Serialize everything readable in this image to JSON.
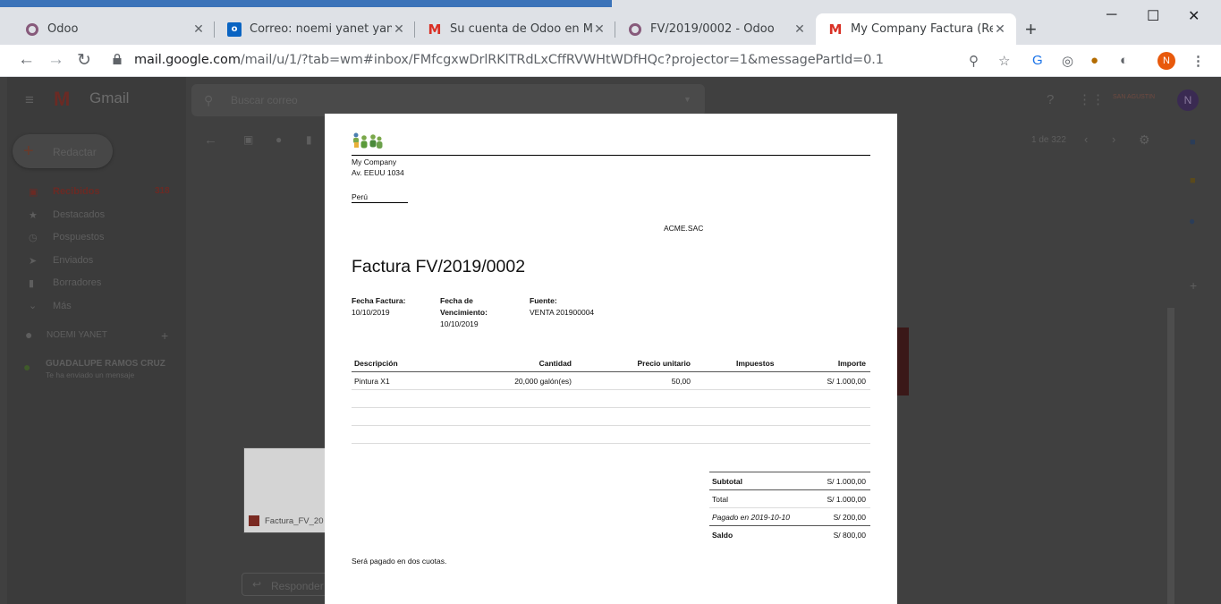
{
  "browser": {
    "tabs": [
      {
        "label": "Odoo",
        "icon": "odoo-icon"
      },
      {
        "label": "Correo: noemi yanet yanqui cu",
        "icon": "outlook-icon"
      },
      {
        "label": "Su cuenta de Odoo en My Cor",
        "icon": "gmail-icon"
      },
      {
        "label": "FV/2019/0002 - Odoo",
        "icon": "odoo-icon"
      },
      {
        "label": "My Company Factura (Ref FV/",
        "icon": "gmail-icon"
      }
    ],
    "url_host": "mail.google.com",
    "url_path": "/mail/u/1/?tab=wm#inbox/FMfcgxwDrlRKlTRdLxCffRVWHtWDfHQc?projector=1&messagePartId=0.1",
    "profile_initial": "N"
  },
  "gmail": {
    "logo": "Gmail",
    "search_placeholder": "Buscar correo",
    "compose": "Redactar",
    "nav": [
      {
        "label": "Recibidos",
        "count": "318"
      },
      {
        "label": "Destacados",
        "count": ""
      },
      {
        "label": "Pospuestos",
        "count": ""
      },
      {
        "label": "Enviados",
        "count": ""
      },
      {
        "label": "Borradores",
        "count": ""
      },
      {
        "label": "Más",
        "count": ""
      }
    ],
    "user": "NOEMI YANET",
    "chat_name": "GUADALUPE RAMOS CRUZ",
    "chat_msg": "Te ha enviado un mensaje",
    "pager": "1 de 322",
    "attachment": "Factura_FV_20",
    "reply": "Responder",
    "org_badge": "SAN AGUSTIN",
    "avatar_initial": "N"
  },
  "invoice": {
    "company_name": "My Company",
    "company_address": "Av. EEUU 1034",
    "company_country": "Perú",
    "customer": "ACME.SAC",
    "title": "Factura FV/2019/0002",
    "date_label": "Fecha Factura:",
    "date_value": "10/10/2019",
    "due_label_1": "Fecha de",
    "due_label_2": "Vencimiento:",
    "due_value": "10/10/2019",
    "source_label": "Fuente:",
    "source_value": "VENTA 201900004",
    "columns": [
      "Descripción",
      "Cantidad",
      "Precio unitario",
      "Impuestos",
      "Importe"
    ],
    "lines": [
      {
        "description": "Pintura X1",
        "quantity": "20,000 galón(es)",
        "unit_price": "50,00",
        "taxes": "",
        "amount": "S/ 1.000,00"
      }
    ],
    "totals": [
      {
        "label": "Subtotal",
        "value": "S/ 1.000,00"
      },
      {
        "label": "Total",
        "value": "S/ 1.000,00"
      },
      {
        "label": "Pagado en 2019-10-10",
        "value": "S/ 200,00"
      },
      {
        "label": "Saldo",
        "value": "S/ 800,00"
      }
    ],
    "note": "Será pagado en dos cuotas."
  }
}
